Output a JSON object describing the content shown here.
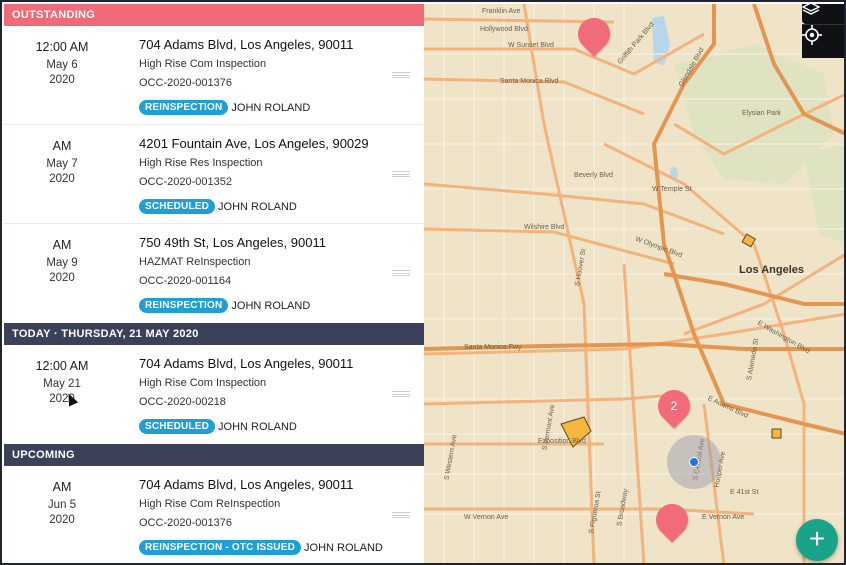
{
  "sections": {
    "outstanding": "OUTSTANDING",
    "today": "TODAY · THURSDAY, 21 MAY 2020",
    "upcoming": "UPCOMING"
  },
  "outstanding_items": [
    {
      "time": "12:00 AM",
      "date": "May 6",
      "year": "2020",
      "address": "704 Adams Blvd, Los Angeles, 90011",
      "type": "High Rise Com Inspection",
      "case": "OCC-2020-001376",
      "status": "REINSPECTION",
      "inspector": "JOHN ROLAND"
    },
    {
      "time": "AM",
      "date": "May 7",
      "year": "2020",
      "address": "4201 Fountain Ave, Los Angeles, 90029",
      "type": "High Rise Res Inspection",
      "case": "OCC-2020-001352",
      "status": "SCHEDULED",
      "inspector": "JOHN ROLAND"
    },
    {
      "time": "AM",
      "date": "May 9",
      "year": "2020",
      "address": "750 49th St, Los Angeles, 90011",
      "type": "HAZMAT ReInspection",
      "case": "OCC-2020-001164",
      "status": "REINSPECTION",
      "inspector": "JOHN ROLAND"
    }
  ],
  "today_items": [
    {
      "time": "12:00 AM",
      "date": "May 21",
      "year": "2020",
      "address": "704 Adams Blvd, Los Angeles, 90011",
      "type": "High Rise Com Inspection",
      "case": "OCC-2020-00218",
      "status": "SCHEDULED",
      "inspector": "JOHN ROLAND"
    }
  ],
  "upcoming_items": [
    {
      "time": "AM",
      "date": "Jun 5",
      "year": "2020",
      "address": "704 Adams Blvd, Los Angeles, 90011",
      "type": "High Rise Com ReInspection",
      "case": "OCC-2020-001376",
      "status": "REINSPECTION - OTC ISSUED",
      "inspector": "JOHN ROLAND"
    }
  ],
  "map": {
    "city": "Los Angeles",
    "cluster_count": "2",
    "labels": {
      "franklin": "Franklin Ave",
      "hollywood": "Hollywood Blvd",
      "sunset": "W Sunset Blvd",
      "santa_monica": "Santa Monica Blvd",
      "griffith": "Griffith Park Blvd",
      "glendale": "Glendale Blvd",
      "elysian": "Elysian Park",
      "beverly": "Beverly Blvd",
      "temple": "W Temple St",
      "wilshire": "Wilshire Blvd",
      "olympic": "W Olympic Blvd",
      "santa_monica_fwy": "Santa Monica Fwy",
      "exposition": "Exposition Blvd",
      "w_vernon": "W Vernon Ave",
      "e_vernon": "E Vernon Ave",
      "adams": "E Adams Blvd",
      "washington": "E Washington Blvd",
      "e41st": "E 41st St",
      "central": "S Central Ave",
      "hooper": "Hooper Ave",
      "alameda": "S Alameda St",
      "vermont": "S Vermont Ave",
      "western": "S Western Ave",
      "broadway": "S Broadway",
      "figueroa": "S Figueroa St",
      "hoover": "S Hoover St"
    }
  },
  "icons": {
    "layers": "layers-icon",
    "locate": "locate-icon",
    "add": "add-icon"
  },
  "colors": {
    "outstanding": "#f06a7a",
    "section_dark": "#3b4158",
    "badge": "#1e9fd8",
    "pin": "#f26b7a",
    "fab": "#17a488"
  }
}
